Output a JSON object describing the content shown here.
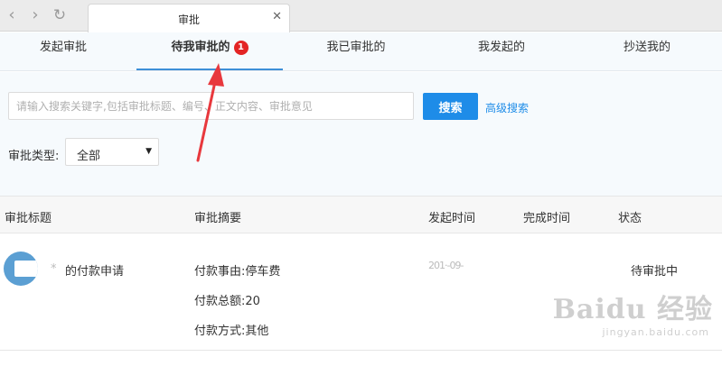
{
  "browser": {
    "tab_title": "审批",
    "tab_close": "✕",
    "back_icon": "‹",
    "forward_icon": "›",
    "reload_icon": "↻"
  },
  "app_tabs": [
    {
      "label": "发起审批",
      "active": false
    },
    {
      "label": "待我审批的",
      "active": true,
      "badge": "1"
    },
    {
      "label": "我已审批的",
      "active": false
    },
    {
      "label": "我发起的",
      "active": false
    },
    {
      "label": "抄送我的",
      "active": false
    }
  ],
  "search": {
    "placeholder": "请输入搜索关键字,包括审批标题、编号、正文内容、审批意见",
    "button_label": "搜索",
    "advanced_link": "高级搜索"
  },
  "filter": {
    "type_label": "审批类型:",
    "type_value": "全部",
    "caret": "▼"
  },
  "table": {
    "columns": [
      "审批标题",
      "审批摘要",
      "发起时间",
      "完成时间",
      "状态"
    ],
    "rows": [
      {
        "title_prefix": "*",
        "title": "的付款申请",
        "summary": [
          "付款事由:停车费",
          "付款总额:20",
          "付款方式:其他"
        ],
        "start_time": "201·-09-",
        "finish_time": "",
        "status_prefix": "",
        "status": "待审批中"
      }
    ]
  },
  "watermark": {
    "main": "Baidu 经验",
    "sub": "jingyan.baidu.com"
  },
  "colors": {
    "accent": "#1e8ce8",
    "active_tab_underline": "#3d8fd8",
    "badge": "#e32424",
    "annotation_arrow": "#e8383d"
  }
}
